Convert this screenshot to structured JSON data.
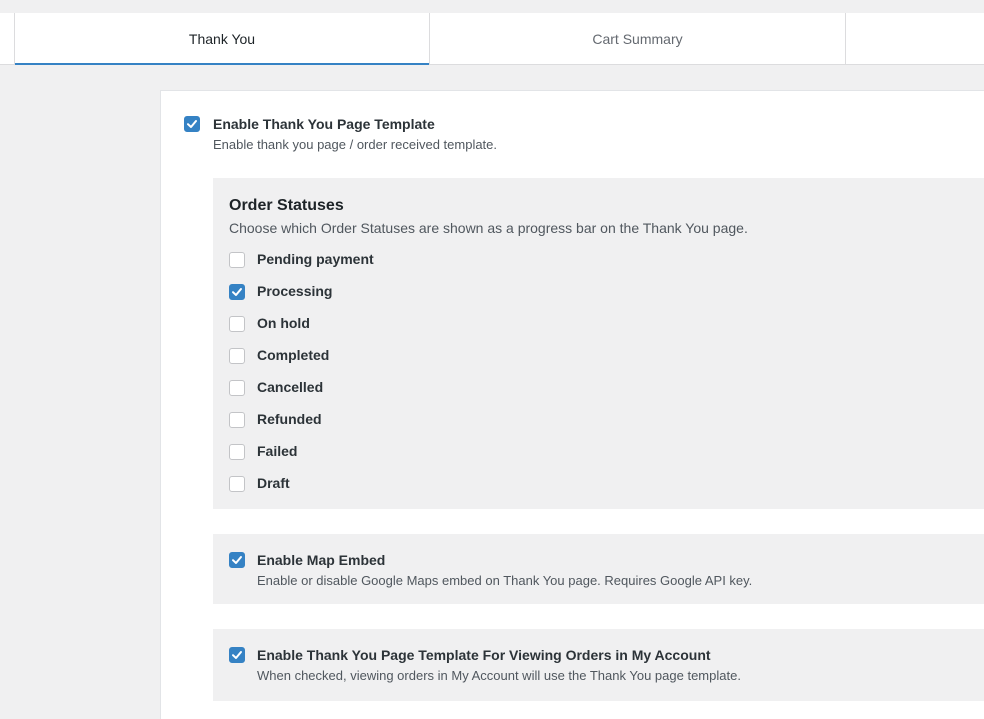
{
  "tabs": [
    {
      "label": "Thank You",
      "active": true
    },
    {
      "label": "Cart Summary",
      "active": false
    },
    {
      "label": "",
      "active": false
    }
  ],
  "main_toggle": {
    "label": "Enable Thank You Page Template",
    "description": "Enable thank you page / order received template.",
    "checked": true
  },
  "order_statuses": {
    "title": "Order Statuses",
    "description": "Choose which Order Statuses are shown as a progress bar on the Thank You page.",
    "items": [
      {
        "label": "Pending payment",
        "checked": false
      },
      {
        "label": "Processing",
        "checked": true
      },
      {
        "label": "On hold",
        "checked": false
      },
      {
        "label": "Completed",
        "checked": false
      },
      {
        "label": "Cancelled",
        "checked": false
      },
      {
        "label": "Refunded",
        "checked": false
      },
      {
        "label": "Failed",
        "checked": false
      },
      {
        "label": "Draft",
        "checked": false
      }
    ]
  },
  "map_embed": {
    "label": "Enable Map Embed",
    "description": "Enable or disable Google Maps embed on Thank You page. Requires Google API key.",
    "checked": true
  },
  "my_account": {
    "label": "Enable Thank You Page Template For Viewing Orders in My Account",
    "description": "When checked, viewing orders in My Account will use the Thank You page template.",
    "checked": true
  },
  "colors": {
    "accent": "#3582c4",
    "page_bg": "#f0f0f1",
    "panel_bg": "#ffffff"
  }
}
